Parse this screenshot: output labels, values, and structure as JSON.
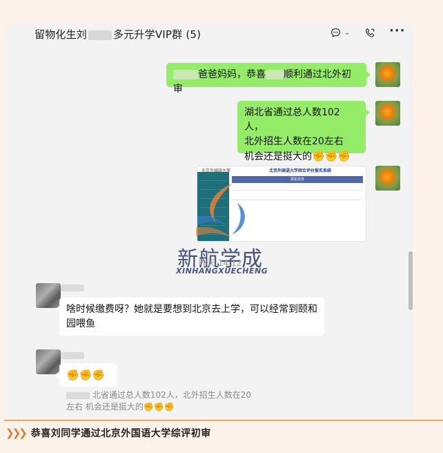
{
  "header": {
    "title_prefix": "留物化生刘",
    "title_suffix": "多元升学VIP群 (5)"
  },
  "messages": {
    "m1_prefix": "爸爸妈妈，恭喜",
    "m1_suffix": "顺利通过北外初审",
    "m2_lines": [
      "湖北省通过总人数102人，",
      "北外招生人数在20左右",
      "机会还是挺大的"
    ],
    "m2_emojis": "✊✊✊",
    "screenshot": {
      "header": "北京外国语大学综合评价报名系统",
      "bar_label": "报名信息"
    },
    "time": "昨天 14:12",
    "m3": "啥时候缴费呀？她就是要想到北京去上学，可以经常到颐和园喂鱼",
    "m4_emojis": "✊✊✊",
    "quote_line1": "北省通过总人数102人，北外招生人数在20",
    "quote_line2": "左右 机会还是挺大的",
    "quote_emojis": "✊✊✊"
  },
  "watermark": {
    "cn": "新航学成",
    "en": "XINHANGXUECHENG"
  },
  "caption": {
    "text": "恭喜刘同学通过北京外国语大学综评初审"
  }
}
